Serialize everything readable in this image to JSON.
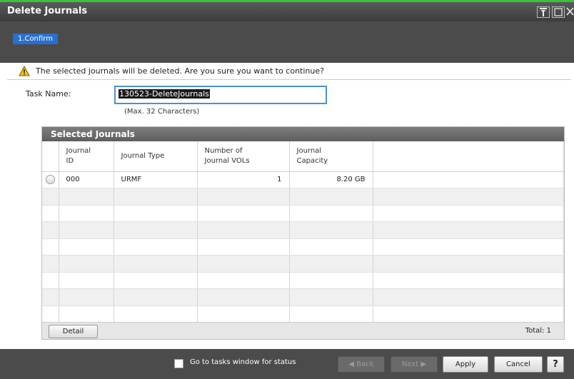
{
  "window": {
    "title": "Delete Journals",
    "pin_icon": "pin-icon",
    "maximize_icon": "maximize-icon",
    "close_icon": "close-icon",
    "accent_color": "#3fbf3f"
  },
  "steps": [
    {
      "label": "1.Confirm",
      "active": true
    }
  ],
  "warning": {
    "icon": "warning-icon",
    "text": "The selected journals will be deleted. Are you sure you want to continue?"
  },
  "task": {
    "label": "Task Name:",
    "value": "130523-DeleteJournals",
    "hint": "(Max. 32 Characters)"
  },
  "selected_journals": {
    "title": "Selected Journals",
    "columns": [
      "Journal ID",
      "Journal Type",
      "Number of Journal VOLs",
      "Journal Capacity"
    ],
    "column_lines": [
      [
        "Journal",
        "ID"
      ],
      [
        "Journal Type"
      ],
      [
        "Number of",
        "Journal VOLs"
      ],
      [
        "Journal",
        "Capacity"
      ]
    ],
    "rows": [
      {
        "id": "000",
        "type": "URMF",
        "vols": "1",
        "capacity": "8.20 GB"
      }
    ],
    "detail_label": "Detail",
    "total_label": "Total:",
    "total_value": "1"
  },
  "footer": {
    "checkbox_label": "Go to tasks window for status",
    "checkbox_checked": false,
    "back_label": "Back",
    "next_label": "Next",
    "apply_label": "Apply",
    "cancel_label": "Cancel",
    "help_label": "?"
  }
}
